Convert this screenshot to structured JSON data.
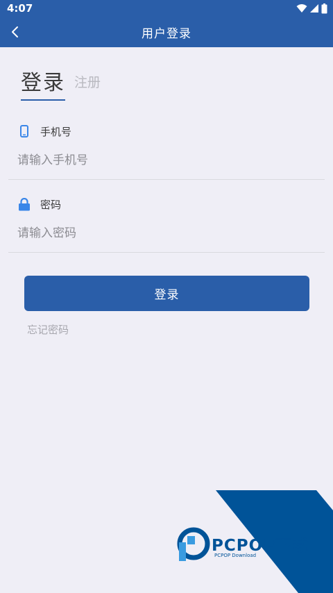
{
  "status_bar": {
    "time": "4:07",
    "icons": [
      "wifi-icon",
      "signal-icon",
      "battery-icon"
    ]
  },
  "nav": {
    "title": "用户登录",
    "back_icon": "chevron-left-icon"
  },
  "tabs": {
    "login": "登录",
    "register": "注册"
  },
  "phone_field": {
    "label": "手机号",
    "placeholder": "请输入手机号",
    "value": "",
    "icon": "phone-icon"
  },
  "password_field": {
    "label": "密码",
    "placeholder": "请输入密码",
    "value": "",
    "icon": "lock-icon"
  },
  "login_button": "登录",
  "forgot_password": "忘记密码",
  "watermark": {
    "brand": "PCPOP下载",
    "sub": "PCPOP Download"
  },
  "colors": {
    "primary": "#2a5ea9",
    "background": "#efeef6",
    "accent_icon": "#3a86e8",
    "watermark": "#005398"
  }
}
